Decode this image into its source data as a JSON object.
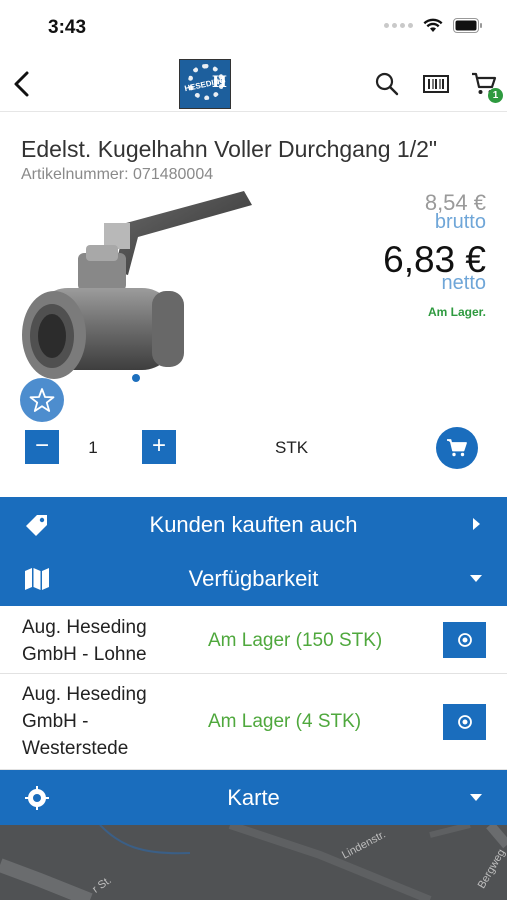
{
  "status_bar": {
    "time": "3:43"
  },
  "nav": {
    "logo_text": "HESEDING",
    "logo_letter": "H",
    "cart_count": "1"
  },
  "product": {
    "title": "Edelst. Kugelhahn Voller Durchgang 1/2\"",
    "article_number": "Artikelnummer: 071480004",
    "price_gross": "8,54 €",
    "label_gross": "brutto",
    "price_net": "6,83 €",
    "label_net": "netto",
    "stock_status": "Am Lager."
  },
  "quantity": {
    "minus": "−",
    "value": "1",
    "plus": "+",
    "unit": "STK"
  },
  "sections": {
    "customers_also_bought": "Kunden kauften auch",
    "availability": "Verfügbarkeit",
    "map": "Karte"
  },
  "stores": [
    {
      "name": "Aug. Heseding GmbH - Lohne",
      "stock": "Am Lager (150 STK)"
    },
    {
      "name": "Aug. Heseding GmbH - Westerstede",
      "stock": "Am Lager (4 STK)"
    }
  ],
  "map_labels": {
    "street_1": "Lindenstr.",
    "street_2": "Bergweg",
    "street_3": "r St."
  },
  "colors": {
    "primary": "#1a6dbd",
    "in_stock": "#4fa83d",
    "badge": "#2e9a3f",
    "price_label": "#6fa6d8"
  }
}
